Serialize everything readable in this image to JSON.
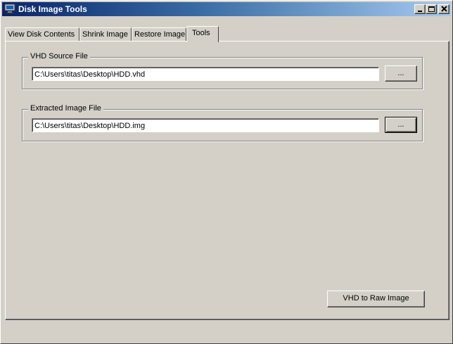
{
  "window": {
    "title": "Disk Image Tools",
    "accent_color": "#0a246a"
  },
  "title_buttons": {
    "minimize_icon": "minimize-icon",
    "maximize_icon": "maximize-icon",
    "close_icon": "close-icon"
  },
  "tabs": [
    {
      "label": "View Disk Contents",
      "active": false
    },
    {
      "label": "Shrink Image",
      "active": false
    },
    {
      "label": "Restore Image",
      "active": false
    },
    {
      "label": "Tools",
      "active": true
    }
  ],
  "vhd_source": {
    "label": "VHD Source File",
    "value": "C:\\Users\\titas\\Desktop\\HDD.vhd",
    "browse_label": "..."
  },
  "extracted_image": {
    "label": "Extracted Image File",
    "value": "C:\\Users\\titas\\Desktop\\HDD.img",
    "browse_label": "..."
  },
  "actions": {
    "convert_label": "VHD to Raw Image"
  }
}
